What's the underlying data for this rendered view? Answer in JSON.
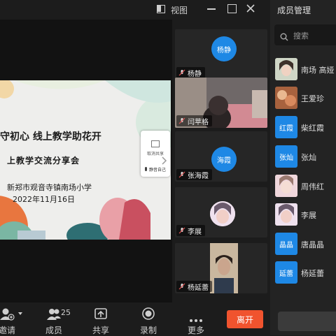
{
  "topbar": {
    "view_label": "视图"
  },
  "slide": {
    "title": "守初心  线上教学助花开",
    "subtitle": "上教学交流分享会",
    "school": "新郑市观音寺镇南场小学",
    "date": "2022年11月16日",
    "float_card": {
      "share_label": "取消共享",
      "mute_label": "静音自己"
    }
  },
  "video_strip": {
    "tiles": [
      {
        "name": "杨静",
        "avatar_text": "杨静"
      },
      {
        "name": "闫苹格"
      },
      {
        "name": "张海霞",
        "avatar_text": "海霞"
      },
      {
        "name": "李展"
      },
      {
        "name": "杨延蕾"
      }
    ]
  },
  "panel": {
    "title": "成员管理",
    "search_placeholder": "搜索",
    "members": [
      {
        "name": "南场  高娅",
        "avatar_text": ""
      },
      {
        "name": "王爱珍",
        "avatar_text": ""
      },
      {
        "name": "柴红霞",
        "avatar_text": "红霞"
      },
      {
        "name": "张灿",
        "avatar_text": "张灿"
      },
      {
        "name": "周伟红",
        "avatar_text": ""
      },
      {
        "name": "李展",
        "avatar_text": ""
      },
      {
        "name": "唐晶晶",
        "avatar_text": "晶晶"
      },
      {
        "name": "杨延蕾",
        "avatar_text": "延蕾"
      }
    ]
  },
  "bottombar": {
    "invite_label": "邀请",
    "members_label": "成员",
    "member_count": "25",
    "share_label": "共享",
    "record_label": "录制",
    "more_label": "更多",
    "leave_label": "离开"
  },
  "colors": {
    "accent_blue": "#1e88e5",
    "leave_red": "#f0532e"
  }
}
